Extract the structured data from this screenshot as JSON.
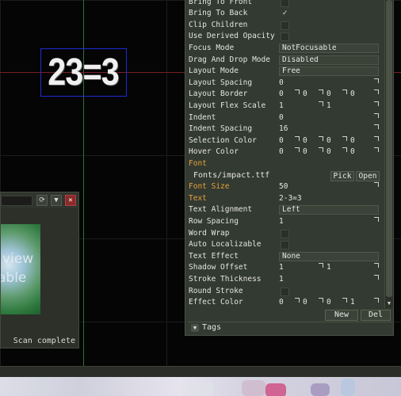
{
  "canvas": {
    "element_text": "23=3"
  },
  "resource_window": {
    "icons": [
      "refresh-icon",
      "filter-icon",
      "close-icon"
    ],
    "preview_text": [
      "view",
      "able"
    ],
    "status": "Scan complete"
  },
  "properties": {
    "rows": [
      {
        "label": "Bring To Front",
        "kind": "check",
        "checked": false
      },
      {
        "label": "Bring To Back",
        "kind": "check",
        "checked": true
      },
      {
        "label": "Clip Children",
        "kind": "check",
        "checked": false
      },
      {
        "label": "Use Derived Opacity",
        "kind": "check",
        "checked": false
      },
      {
        "label": "Focus Mode",
        "kind": "field",
        "value": "NotFocusable"
      },
      {
        "label": "Drag And Drop Mode",
        "kind": "field",
        "value": "Disabled"
      },
      {
        "label": "Layout Mode",
        "kind": "field",
        "value": "Free"
      },
      {
        "label": "Layout Spacing",
        "kind": "nums",
        "values": [
          "0"
        ]
      },
      {
        "label": "Layout Border",
        "kind": "nums",
        "values": [
          "0",
          "0",
          "0",
          "0"
        ]
      },
      {
        "label": "Layout Flex Scale",
        "kind": "nums",
        "values": [
          "1",
          "1"
        ]
      },
      {
        "label": "Indent",
        "kind": "nums",
        "values": [
          "0"
        ]
      },
      {
        "label": "Indent Spacing",
        "kind": "nums",
        "values": [
          "16"
        ]
      },
      {
        "label": "Selection Color",
        "kind": "nums",
        "values": [
          "0",
          "0",
          "0",
          "0"
        ]
      },
      {
        "label": "Hover Color",
        "kind": "nums",
        "values": [
          "0",
          "0",
          "0",
          "0"
        ]
      },
      {
        "label": "Font",
        "kind": "header",
        "highlight": true
      },
      {
        "label": "Fonts/impact.ttf",
        "kind": "fontpath",
        "buttons": [
          "Pick",
          "Open"
        ]
      },
      {
        "label": "Font Size",
        "kind": "nums",
        "values": [
          "50"
        ],
        "highlight": true
      },
      {
        "label": "Text",
        "kind": "text",
        "value": "2-3=3",
        "highlight": true
      },
      {
        "label": "Text Alignment",
        "kind": "field",
        "value": "Left"
      },
      {
        "label": "Row Spacing",
        "kind": "nums",
        "values": [
          "1"
        ]
      },
      {
        "label": "Word Wrap",
        "kind": "check",
        "checked": false
      },
      {
        "label": "Auto Localizable",
        "kind": "check",
        "checked": false
      },
      {
        "label": "Text Effect",
        "kind": "field",
        "value": "None"
      },
      {
        "label": "Shadow Offset",
        "kind": "nums",
        "values": [
          "1",
          "1"
        ]
      },
      {
        "label": "Stroke Thickness",
        "kind": "nums",
        "values": [
          "1"
        ]
      },
      {
        "label": "Round Stroke",
        "kind": "check",
        "checked": false
      },
      {
        "label": "Effect Color",
        "kind": "nums",
        "values": [
          "0",
          "0",
          "0",
          "1"
        ]
      }
    ],
    "new_label": "New",
    "del_label": "Del",
    "tags_label": "Tags"
  },
  "colors": {
    "highlight": "#e7a23a",
    "panel_bg": "#333a31",
    "selection_box": "#1d2bd6",
    "x_axis": "#7a1e26",
    "y_axis": "#2f6f3a"
  }
}
